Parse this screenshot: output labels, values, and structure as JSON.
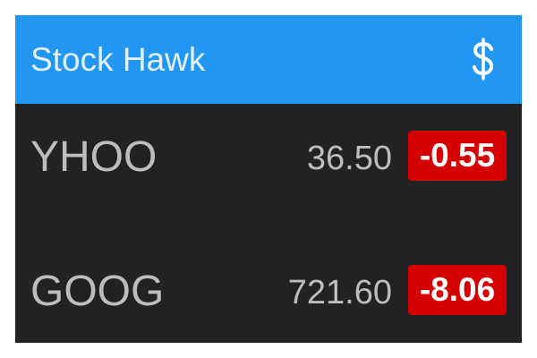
{
  "appbar": {
    "title": "Stock Hawk",
    "icon": "dollar-icon"
  },
  "colors": {
    "appbar": "#2196f3",
    "background": "#222222",
    "negative_change": "#d50000",
    "text": "#bdbdbd"
  },
  "stocks": [
    {
      "symbol": "YHOO",
      "price": "36.50",
      "change": "-0.55"
    },
    {
      "symbol": "GOOG",
      "price": "721.60",
      "change": "-8.06"
    }
  ]
}
